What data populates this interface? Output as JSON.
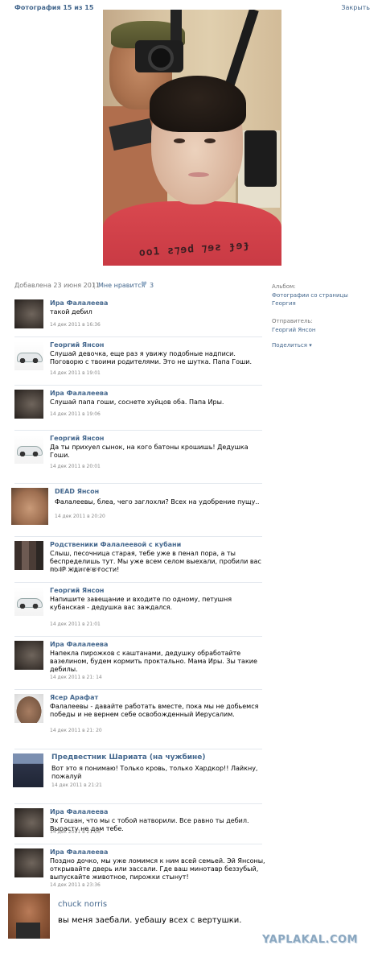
{
  "header": {
    "title": "Фотография 15 из 15",
    "close": "Закрыть"
  },
  "photo": {
    "shirt_text": "oo1 ƨ⁊ɘd ⁊ɘƨ ɟɘɟ"
  },
  "info": {
    "added": "Добавлена 23 июня 2011",
    "separator": "|",
    "like_label": "Мне нравится",
    "like_count": "3"
  },
  "sidebar": {
    "album_label": "Альбом:",
    "album_value": "Фотографии со страницы Георгия",
    "sender_label": "Отправитель:",
    "sender_value": "Георгий Янсон",
    "share": "Поделиться ▾"
  },
  "comments": [
    {
      "name": "Ира Фалалеева",
      "text": "такой дебил",
      "date": "14 дек 2011 в 16:36"
    },
    {
      "name": "Георгий Янсон",
      "text": "Слушай девочка, еще раз я увижу подобные надписи. Поговорю с твоими родителями. Это не шутка. Папа Гоши.",
      "date": "14 дек 2011 в 19:01"
    },
    {
      "name": "Ира Фалалеева",
      "text": "Слушай папа гоши, соснете хуйцов оба.  Папа Иры.",
      "date": "14 дек 2011 в 19:06"
    },
    {
      "name": "Георгий Янсон",
      "text": "Да ты прихуел сынок, на кого батоны крошишь! Дедушка Гоши.",
      "date": "14 дек 2011 в 20:01"
    },
    {
      "name": "DEAD Янсон",
      "text": "Фалалеевы, блеа, чего заглохли? Всех на удобрение пущу..",
      "date": "14 дек 2011 в 20:20"
    },
    {
      "name": "Родственики Фалалеевой с кубани",
      "text": "Слыш, песочница старая, тебе уже в пенал пора, а ты беспределишь тут. Мы уже всем селом выехали, пробили вас по IP ждите в гости!",
      "date": "14 дек 2011 в 20:36"
    },
    {
      "name": "Георгий Янсон",
      "text": "Напишите завещание и входите по одному, петушня кубанская - дедушка вас заждался.",
      "date": "14 дек 2011 в 21:01"
    },
    {
      "name": "Ира Фалалеева",
      "text": "Напекла пирожков с каштанами, дедушку обработайте вазелином, будем кормить проктально. Мама Иры. Зы такие дебилы.",
      "date": "14 дек 2011 в 21: 14"
    },
    {
      "name": "Ясер Арафат",
      "text": "Фалалеевы - давайте работать вместе, пока мы не добьемся победы и не вернем себе освобожденный Иерусалим.",
      "date": "14 дек 2011 в 21: 20"
    },
    {
      "name": "Предвестник Шариата (на чужбине)",
      "text": "Вот это я понимаю! Только кровь, только Хардкор!! Лайкну, пожалуй",
      "date": "14 дек 2011 в 21:21"
    },
    {
      "name": "Ира Фалалеева",
      "text": "Эх Гошан, что мы с тобой натворили. Все равно ты дебил. Вырасту не дам тебе.",
      "date": "14 дек 2011 в 21:26"
    },
    {
      "name": "Ира Фалалеева",
      "text": "Поздно дочко, мы уже ломимся к ним всей семьей. Эй Янсоны, открывайте дверь или зассали. Где ваш минотавр беззубый, выпускайте животное, пирожки стынут!",
      "date": "14 дек 2011 в 23:36"
    }
  ],
  "chuck": {
    "name": "chuck norris",
    "text": "вы меня заебали. уебашу всех с вертушки."
  },
  "watermark": "YAPLAKAL.COM"
}
